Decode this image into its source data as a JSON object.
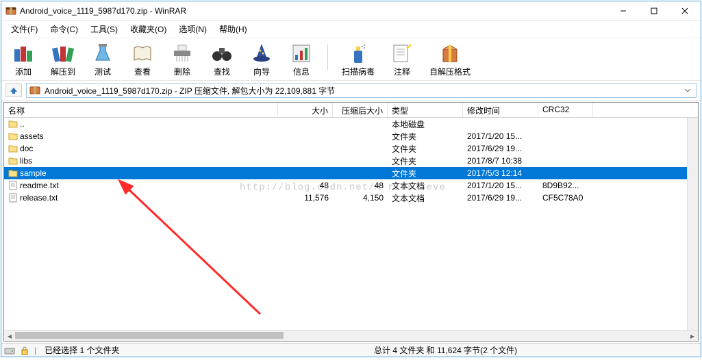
{
  "titlebar": {
    "title": "Android_voice_1119_5987d170.zip - WinRAR"
  },
  "menu": {
    "file": "文件(F)",
    "commands": "命令(C)",
    "tools": "工具(S)",
    "favorites": "收藏夹(O)",
    "options": "选项(N)",
    "help": "帮助(H)"
  },
  "toolbar": {
    "add": "添加",
    "extract": "解压到",
    "test": "测试",
    "view": "查看",
    "delete": "删除",
    "find": "查找",
    "wizard": "向导",
    "info": "信息",
    "scan": "扫描病毒",
    "comment": "注释",
    "sfx": "自解压格式"
  },
  "addr": {
    "text": "Android_voice_1119_5987d170.zip - ZIP 压缩文件, 解包大小为 22,109,881 字节"
  },
  "columns": {
    "name": "名称",
    "size": "大小",
    "packed": "压缩后大小",
    "type": "类型",
    "modified": "修改时间",
    "crc": "CRC32"
  },
  "rows": [
    {
      "name": "..",
      "size": "",
      "packed": "",
      "type": "本地磁盘",
      "modified": "",
      "crc": "",
      "icon": "folder",
      "selected": false
    },
    {
      "name": "assets",
      "size": "",
      "packed": "",
      "type": "文件夹",
      "modified": "2017/1/20 15...",
      "crc": "",
      "icon": "folder",
      "selected": false
    },
    {
      "name": "doc",
      "size": "",
      "packed": "",
      "type": "文件夹",
      "modified": "2017/6/29 19...",
      "crc": "",
      "icon": "folder",
      "selected": false
    },
    {
      "name": "libs",
      "size": "",
      "packed": "",
      "type": "文件夹",
      "modified": "2017/8/7 10:38",
      "crc": "",
      "icon": "folder",
      "selected": false
    },
    {
      "name": "sample",
      "size": "",
      "packed": "",
      "type": "文件夹",
      "modified": "2017/5/3 12:14",
      "crc": "",
      "icon": "folder",
      "selected": true
    },
    {
      "name": "readme.txt",
      "size": "48",
      "packed": "48",
      "type": "文本文档",
      "modified": "2017/1/20 15...",
      "crc": "8D9B92...",
      "icon": "txt",
      "selected": false
    },
    {
      "name": "release.txt",
      "size": "11,576",
      "packed": "4,150",
      "type": "文本文档",
      "modified": "2017/6/29 19...",
      "crc": "CF5C78A0",
      "icon": "txt",
      "selected": false
    }
  ],
  "status": {
    "left": "已经选择 1 个文件夹",
    "mid": "总计 4 文件夹 和 11,624 字节(2 个文件)"
  },
  "watermark": "http://blog.csdn.net/A    rius Seve"
}
